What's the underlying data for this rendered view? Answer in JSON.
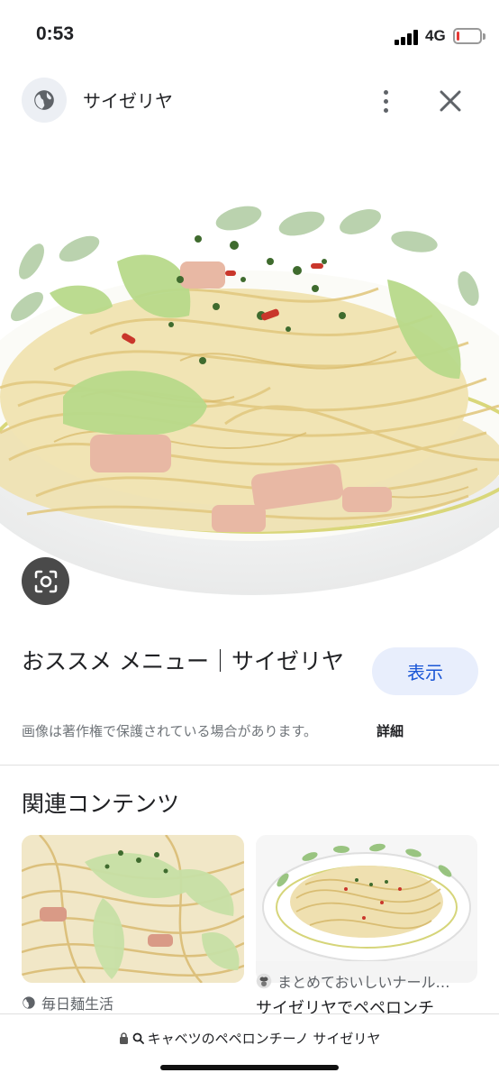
{
  "status_bar": {
    "time": "0:53",
    "network": "4G",
    "battery_level": 0.12,
    "battery_color": "#e53935"
  },
  "header": {
    "site_icon": "globe-icon",
    "site_name": "サイゼリヤ",
    "more_icon": "more-vert-icon",
    "close_icon": "close-icon"
  },
  "hero": {
    "lens_icon": "lens-icon"
  },
  "result": {
    "title": "おススメ メニュー｜サイゼリヤ",
    "view_button": "表示",
    "copyright_notice": "画像は著作権で保護されている場合があります。",
    "details_link": "詳細"
  },
  "related": {
    "heading": "関連コンテンツ",
    "cards": [
      {
        "source": "毎日麺生活",
        "source_icon": "globe-icon"
      },
      {
        "source": "まとめておいしいナール…",
        "source_icon": "chef-icon",
        "title": "サイゼリヤでペペロンチ"
      }
    ]
  },
  "url_bar": {
    "lock_icon": "lock-icon",
    "search_icon": "search-icon",
    "text": "キャベツのペペロンチーノ サイゼリヤ"
  },
  "colors": {
    "accent": "#1a56d6",
    "button_bg": "#e8eefc"
  }
}
